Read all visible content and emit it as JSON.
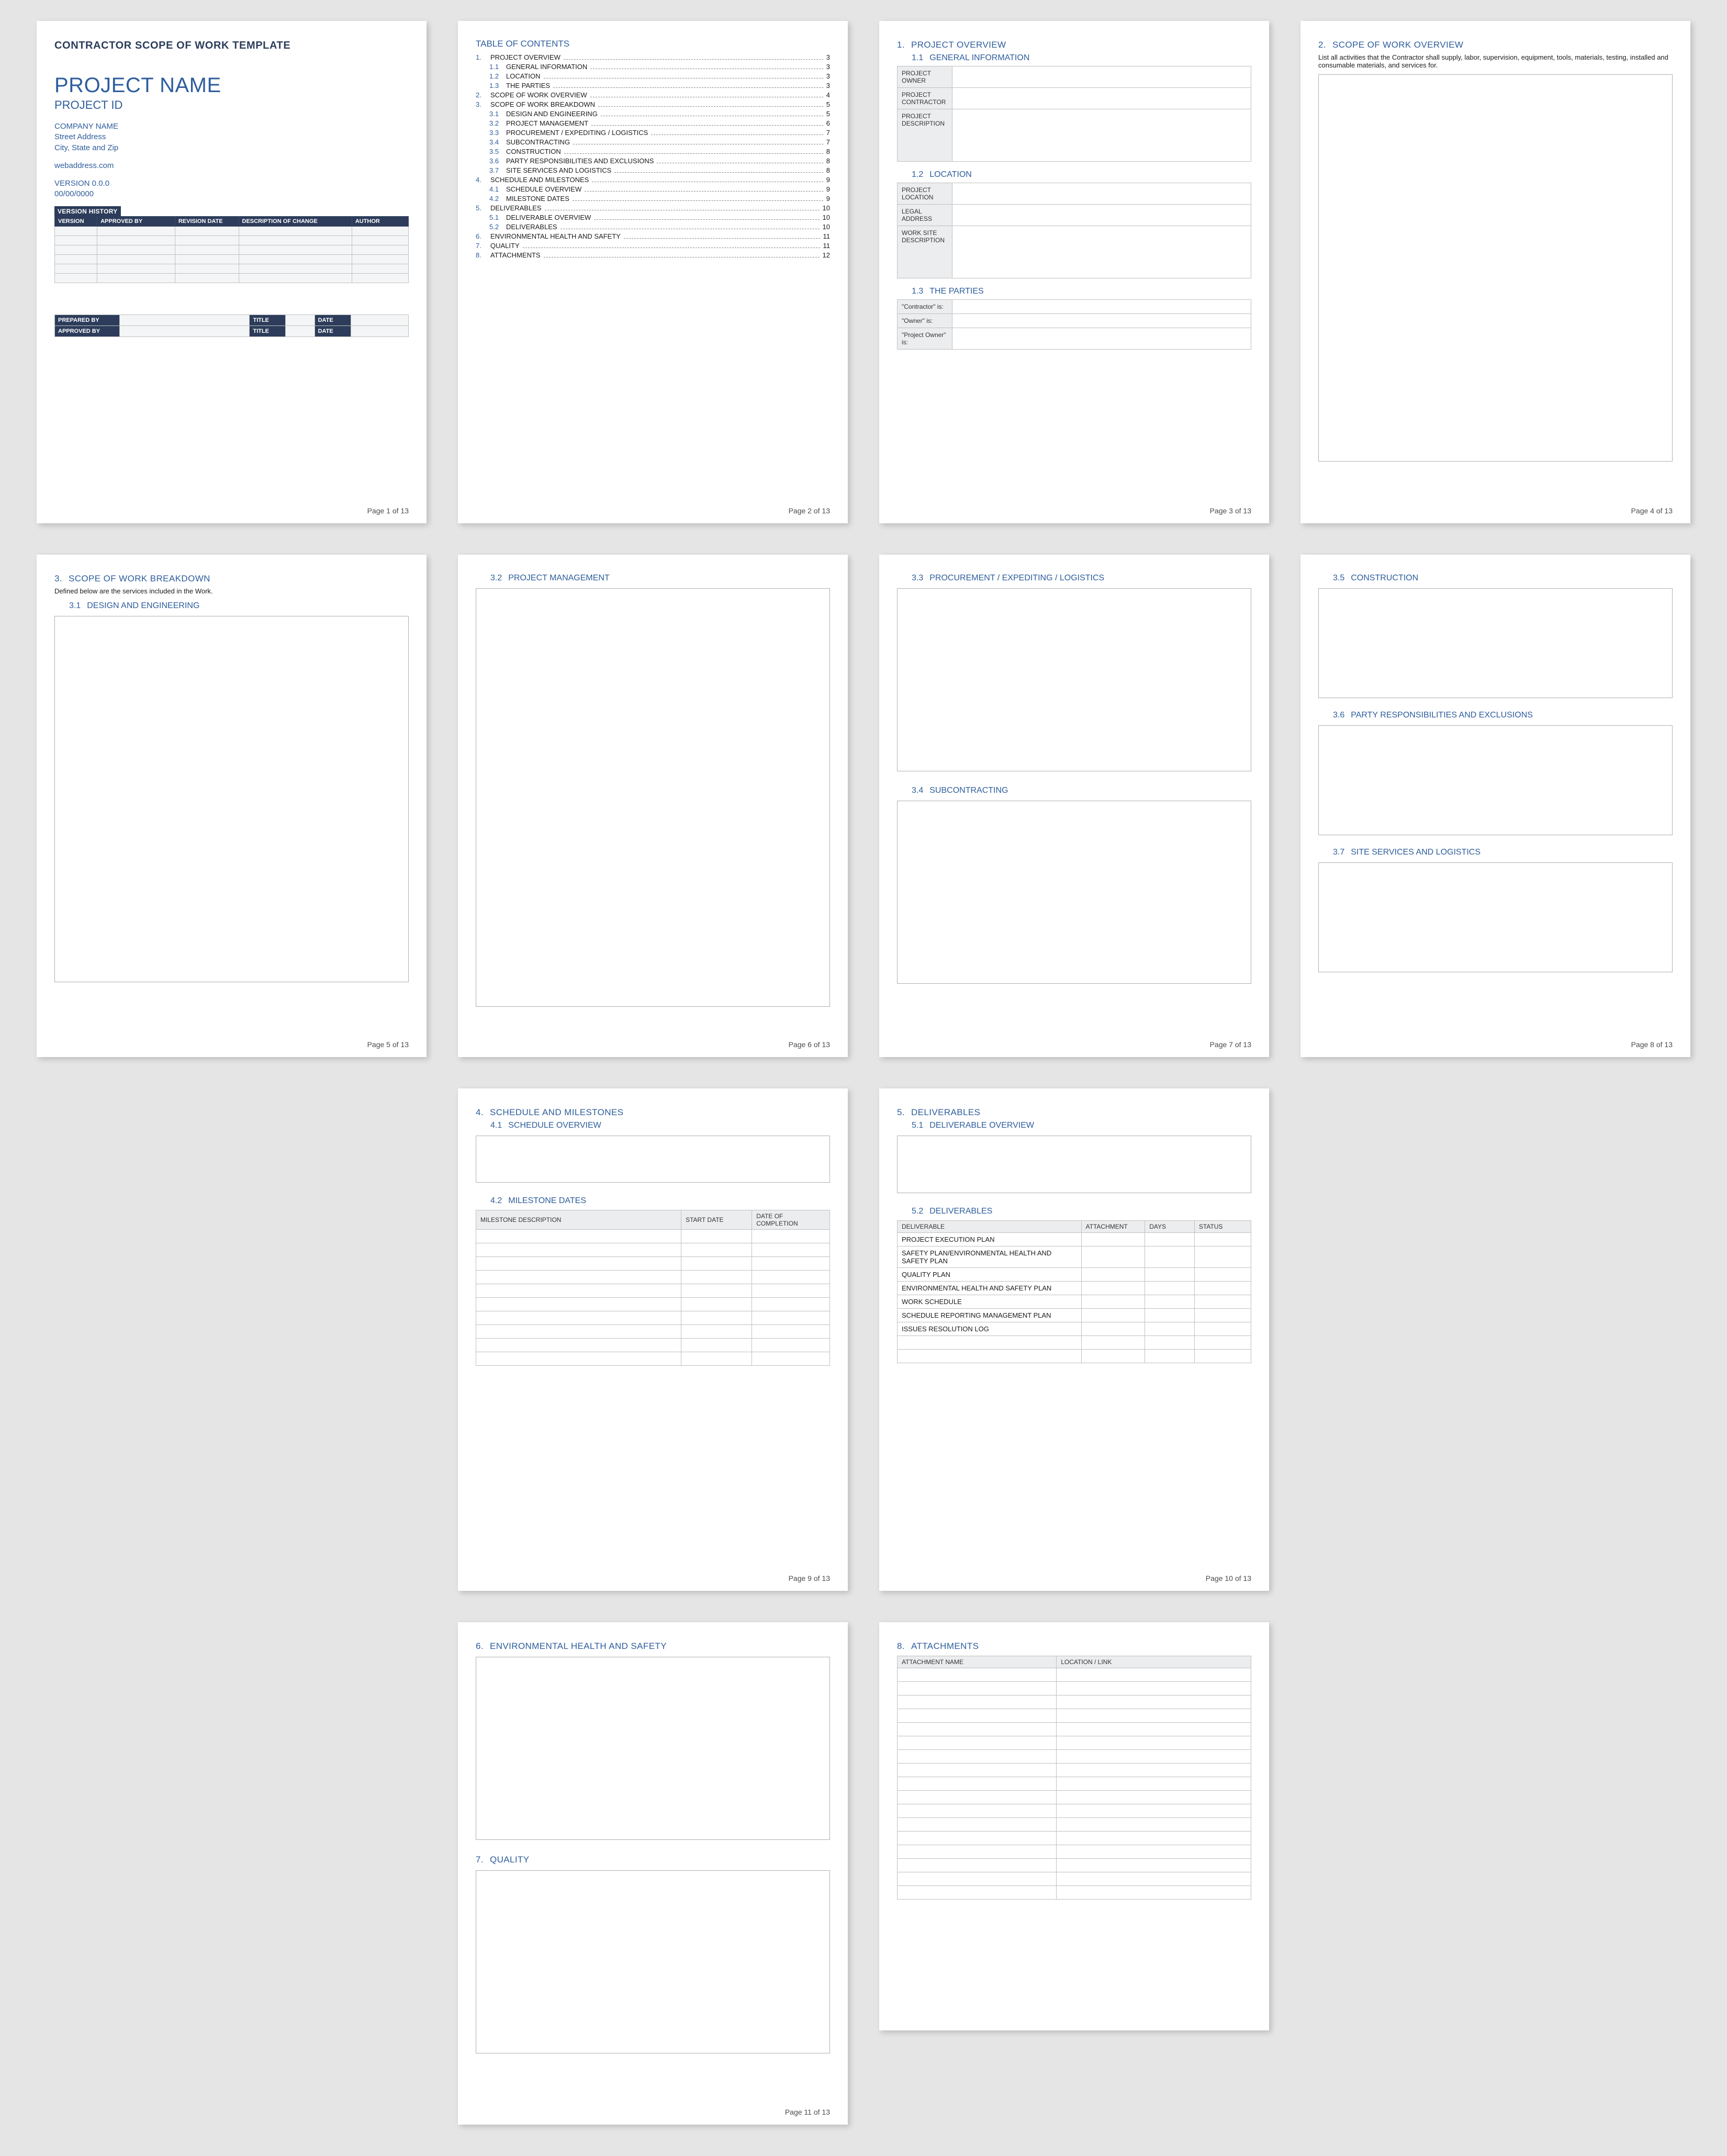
{
  "footer_prefix": "Page ",
  "footer_suffix": " of 13",
  "page1": {
    "heading": "CONTRACTOR SCOPE OF WORK TEMPLATE",
    "project_name": "PROJECT NAME",
    "project_id": "PROJECT ID",
    "company": "COMPANY NAME",
    "address1": "Street Address",
    "address2": "City, State and Zip",
    "web": "webaddress.com",
    "version": "VERSION 0.0.0",
    "date": "00/00/0000",
    "vh_caption": "VERSION HISTORY",
    "vh_cols": [
      "VERSION",
      "APPROVED BY",
      "REVISION DATE",
      "DESCRIPTION OF CHANGE",
      "AUTHOR"
    ],
    "sig": {
      "prepared": "PREPARED BY",
      "approved": "APPROVED BY",
      "title": "TITLE",
      "date": "DATE"
    }
  },
  "toc": {
    "title": "TABLE OF CONTENTS",
    "items": [
      {
        "n": "1.",
        "t": "PROJECT OVERVIEW",
        "p": "3",
        "lvl": 1
      },
      {
        "n": "1.1",
        "t": "GENERAL INFORMATION",
        "p": "3",
        "lvl": 2
      },
      {
        "n": "1.2",
        "t": "LOCATION",
        "p": "3",
        "lvl": 2
      },
      {
        "n": "1.3",
        "t": "THE PARTIES",
        "p": "3",
        "lvl": 2
      },
      {
        "n": "2.",
        "t": "SCOPE OF WORK OVERVIEW",
        "p": "4",
        "lvl": 1
      },
      {
        "n": "3.",
        "t": "SCOPE OF WORK BREAKDOWN",
        "p": "5",
        "lvl": 1
      },
      {
        "n": "3.1",
        "t": "DESIGN AND ENGINEERING",
        "p": "5",
        "lvl": 2
      },
      {
        "n": "3.2",
        "t": "PROJECT MANAGEMENT",
        "p": "6",
        "lvl": 2
      },
      {
        "n": "3.3",
        "t": "PROCUREMENT / EXPEDITING / LOGISTICS",
        "p": "7",
        "lvl": 2
      },
      {
        "n": "3.4",
        "t": "SUBCONTRACTING",
        "p": "7",
        "lvl": 2
      },
      {
        "n": "3.5",
        "t": "CONSTRUCTION",
        "p": "8",
        "lvl": 2
      },
      {
        "n": "3.6",
        "t": "PARTY RESPONSIBILITIES AND EXCLUSIONS",
        "p": "8",
        "lvl": 2
      },
      {
        "n": "3.7",
        "t": "SITE SERVICES AND LOGISTICS",
        "p": "8",
        "lvl": 2
      },
      {
        "n": "4.",
        "t": "SCHEDULE AND MILESTONES",
        "p": "9",
        "lvl": 1
      },
      {
        "n": "4.1",
        "t": "SCHEDULE OVERVIEW",
        "p": "9",
        "lvl": 2
      },
      {
        "n": "4.2",
        "t": "MILESTONE DATES",
        "p": "9",
        "lvl": 2
      },
      {
        "n": "5.",
        "t": "DELIVERABLES",
        "p": "10",
        "lvl": 1
      },
      {
        "n": "5.1",
        "t": "DELIVERABLE OVERVIEW",
        "p": "10",
        "lvl": 2
      },
      {
        "n": "5.2",
        "t": "DELIVERABLES",
        "p": "10",
        "lvl": 2
      },
      {
        "n": "6.",
        "t": "ENVIRONMENTAL HEALTH AND SAFETY",
        "p": "11",
        "lvl": 1
      },
      {
        "n": "7.",
        "t": "QUALITY",
        "p": "11",
        "lvl": 1
      },
      {
        "n": "8.",
        "t": "ATTACHMENTS",
        "p": "12",
        "lvl": 1
      }
    ]
  },
  "p3": {
    "s1": "1.",
    "s1t": "PROJECT OVERVIEW",
    "s11": "1.1",
    "s11t": "GENERAL INFORMATION",
    "rows1": [
      "PROJECT OWNER",
      "PROJECT CONTRACTOR",
      "PROJECT DESCRIPTION"
    ],
    "s12": "1.2",
    "s12t": "LOCATION",
    "rows2": [
      "PROJECT LOCATION",
      "LEGAL ADDRESS",
      "WORK SITE DESCRIPTION"
    ],
    "s13": "1.3",
    "s13t": "THE PARTIES",
    "rows3": [
      "\"Contractor\" is:",
      "\"Owner\" is:",
      "\"Project Owner\" is:"
    ]
  },
  "p4": {
    "s": "2.",
    "t": "SCOPE OF WORK OVERVIEW",
    "intro": "List all activities that the Contractor shall supply, labor, supervision, equipment, tools, materials, testing, installed and consumable materials, and services for."
  },
  "p5": {
    "s": "3.",
    "t": "SCOPE OF WORK BREAKDOWN",
    "intro": "Defined below are the services included in the Work.",
    "s31": "3.1",
    "s31t": "DESIGN AND ENGINEERING"
  },
  "p6": {
    "s32": "3.2",
    "s32t": "PROJECT MANAGEMENT"
  },
  "p7": {
    "s33": "3.3",
    "s33t": "PROCUREMENT / EXPEDITING / LOGISTICS",
    "s34": "3.4",
    "s34t": "SUBCONTRACTING"
  },
  "p8": {
    "s35": "3.5",
    "s35t": "CONSTRUCTION",
    "s36": "3.6",
    "s36t": "PARTY RESPONSIBILITIES AND EXCLUSIONS",
    "s37": "3.7",
    "s37t": "SITE SERVICES AND LOGISTICS"
  },
  "p9": {
    "s": "4.",
    "t": "SCHEDULE AND MILESTONES",
    "s41": "4.1",
    "s41t": "SCHEDULE OVERVIEW",
    "s42": "4.2",
    "s42t": "MILESTONE DATES",
    "cols": [
      "MILESTONE DESCRIPTION",
      "START DATE",
      "DATE OF COMPLETION"
    ]
  },
  "p10": {
    "s": "5.",
    "t": "DELIVERABLES",
    "s51": "5.1",
    "s51t": "DELIVERABLE OVERVIEW",
    "s52": "5.2",
    "s52t": "DELIVERABLES",
    "cols": [
      "DELIVERABLE",
      "ATTACHMENT",
      "DAYS",
      "STATUS"
    ],
    "rows": [
      "PROJECT EXECUTION PLAN",
      "SAFETY PLAN/ENVIRONMENTAL HEALTH AND SAFETY PLAN",
      "QUALITY PLAN",
      "ENVIRONMENTAL HEALTH AND SAFETY PLAN",
      "WORK SCHEDULE",
      "SCHEDULE REPORTING MANAGEMENT PLAN",
      "ISSUES RESOLUTION LOG"
    ]
  },
  "p11": {
    "s6": "6.",
    "s6t": "ENVIRONMENTAL HEALTH AND SAFETY",
    "s7": "7.",
    "s7t": "QUALITY"
  },
  "p12": {
    "s": "8.",
    "t": "ATTACHMENTS",
    "cols": [
      "ATTACHMENT NAME",
      "LOCATION / LINK"
    ]
  }
}
